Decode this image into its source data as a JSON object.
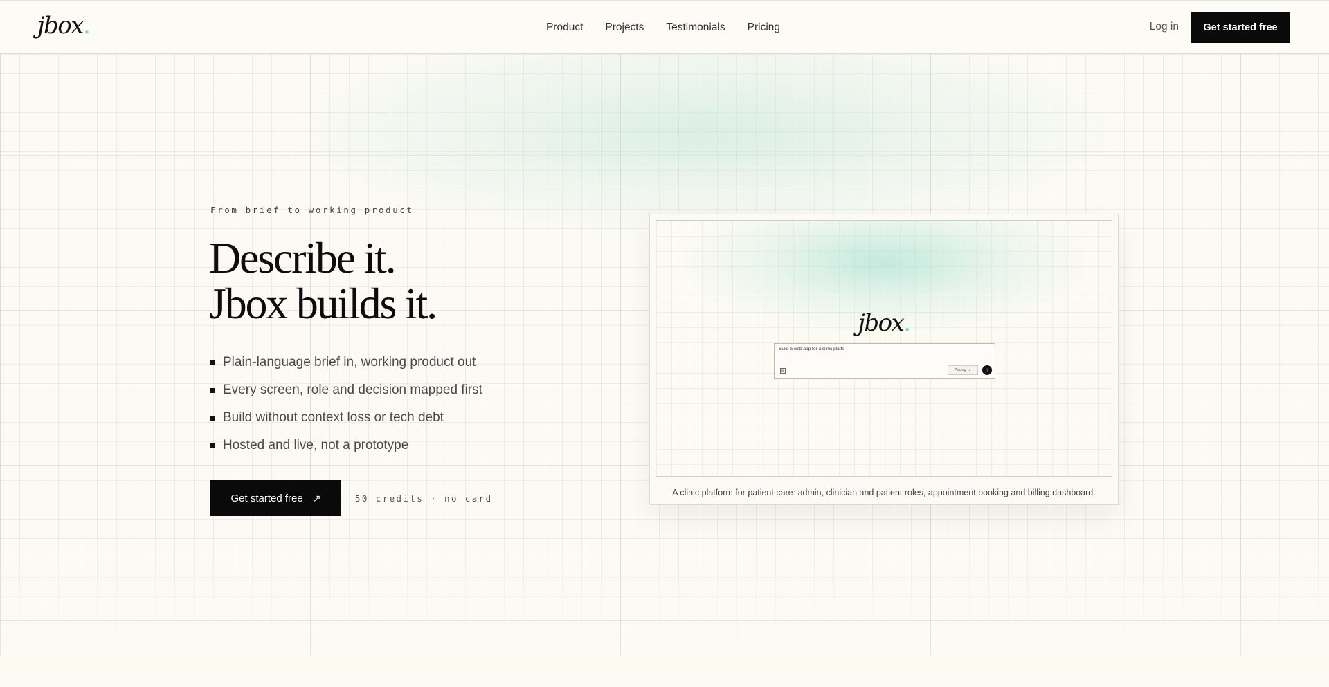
{
  "header": {
    "logo_text": "jbox",
    "logo_dot": ".",
    "nav": [
      "Product",
      "Projects",
      "Testimonials",
      "Pricing"
    ],
    "login_label": "Log in",
    "cta_label": "Get started free"
  },
  "hero": {
    "eyebrow": "From brief to working product",
    "headline_line1": "Describe it.",
    "headline_line2": "Jbox builds it.",
    "bullets": [
      "Plain-language brief in, working product out",
      "Every screen, role and decision mapped first",
      "Build without context loss or tech debt",
      "Hosted and live, not a prototype"
    ],
    "cta_label": "Get started free",
    "cta_icon": "arrow-up-right-icon",
    "credits_note": "50 credits · no card"
  },
  "preview": {
    "logo_text": "jbox",
    "logo_dot": ".",
    "input_text": "Build a web app for a clinic platfo",
    "select_label": "Pricing",
    "send_icon": "arrow-up-icon",
    "caption": "A clinic platform for patient care: admin, clinician and patient roles, appointment booking and billing dashboard."
  },
  "colors": {
    "background": "#fbfaf4",
    "accent": "#7fd6c7",
    "button": "#0a0a0a",
    "glow": "#b2e2d4"
  }
}
